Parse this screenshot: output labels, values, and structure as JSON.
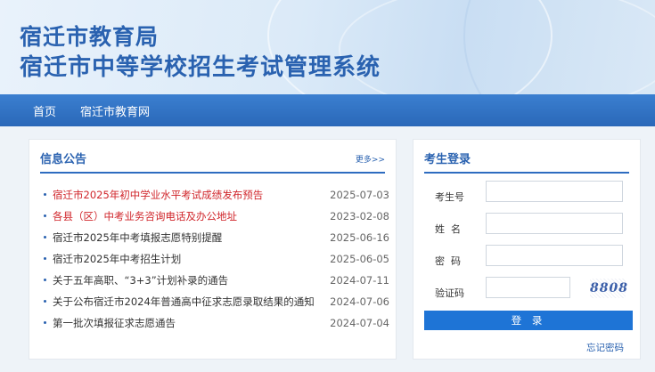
{
  "header": {
    "title_line1": "宿迁市教育局",
    "title_line2": "宿迁市中等学校招生考试管理系统"
  },
  "nav": {
    "items": [
      {
        "label": "首页"
      },
      {
        "label": "宿迁市教育网"
      }
    ]
  },
  "news": {
    "title": "信息公告",
    "more": "更多>>",
    "items": [
      {
        "title": "宿迁市2025年初中学业水平考试成绩发布预告",
        "date": "2025-07-03",
        "highlight": true
      },
      {
        "title": "各县（区）中考业务咨询电话及办公地址",
        "date": "2023-02-08",
        "highlight": true
      },
      {
        "title": "宿迁市2025年中考填报志愿特别提醒",
        "date": "2025-06-16",
        "highlight": false
      },
      {
        "title": "宿迁市2025年中考招生计划",
        "date": "2025-06-05",
        "highlight": false
      },
      {
        "title": "关于五年高职、“3+3”计划补录的通告",
        "date": "2024-07-11",
        "highlight": false
      },
      {
        "title": "关于公布宿迁市2024年普通高中征求志愿录取结果的通知",
        "date": "2024-07-06",
        "highlight": false
      },
      {
        "title": "第一批次填报征求志愿通告",
        "date": "2024-07-04",
        "highlight": false
      }
    ]
  },
  "login": {
    "title": "考生登录",
    "fields": {
      "exam_no": {
        "label": "考生号",
        "value": ""
      },
      "name": {
        "label": "姓  名",
        "value": ""
      },
      "password": {
        "label": "密  码",
        "value": ""
      },
      "captcha": {
        "label": "验证码",
        "value": "",
        "image_text": "8808"
      }
    },
    "submit_label": "登 录",
    "forgot_label": "忘记密码"
  },
  "colors": {
    "brand_blue": "#2a62b0",
    "nav_blue": "#2a68b8",
    "button_blue": "#1e74d6",
    "highlight_red": "#d0262b"
  }
}
